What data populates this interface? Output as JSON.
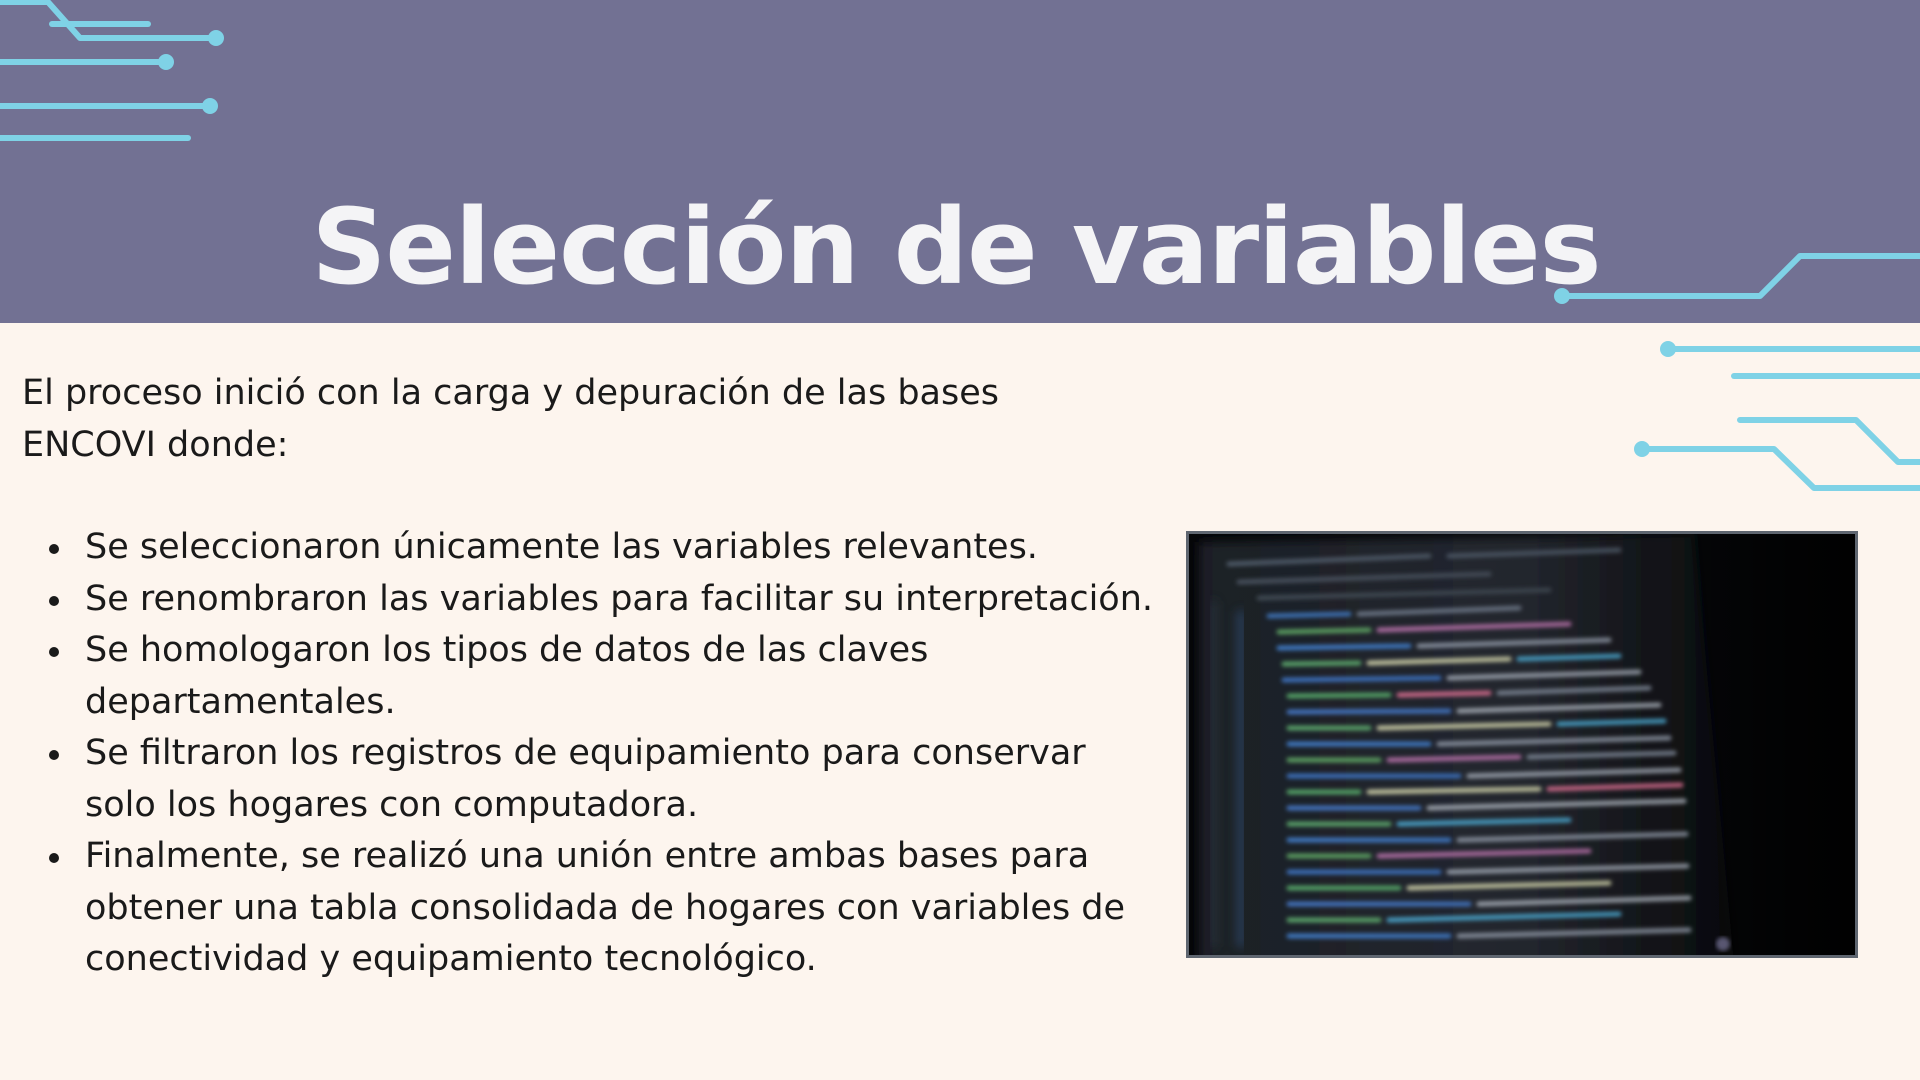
{
  "title": "Selección de variables",
  "intro": "El proceso inició con la carga y depuración de las bases ENCOVI donde:",
  "bullets": [
    "Se seleccionaron únicamente las variables relevantes.",
    "Se renombraron las variables para facilitar su interpretación.",
    "Se homologaron los tipos de datos de las claves departamentales.",
    "Se filtraron los registros de equipamiento para conservar solo los hogares con computadora.",
    "Finalmente, se realizó una unión entre ambas bases para obtener una tabla consolidada de hogares con variables de conectividad y equipamiento tecnológico."
  ],
  "colors": {
    "header_bg": "#727193",
    "body_bg": "#fdf5ee",
    "title_text": "#f4f4f6",
    "circuit_lines": "#7fd2e6",
    "body_text": "#1a1a1a"
  },
  "image": {
    "icon": "code-screen-photo"
  }
}
